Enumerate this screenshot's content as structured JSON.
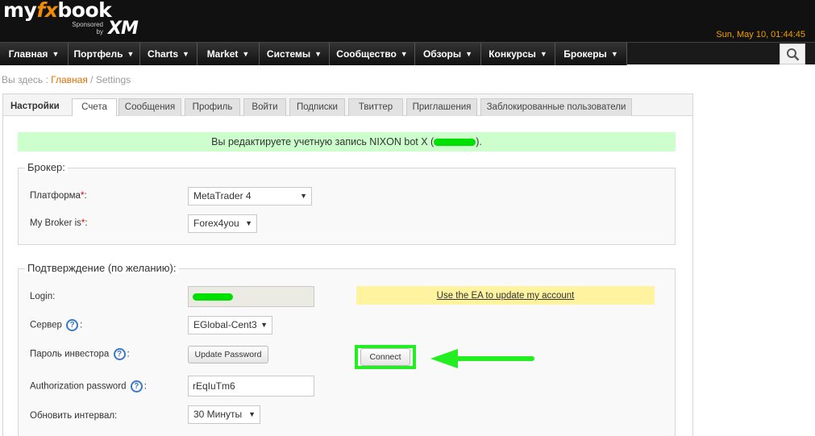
{
  "header": {
    "logo_my": "my",
    "logo_fx": "fx",
    "logo_book": "book",
    "sponsored_line1": "Sponsored",
    "sponsored_line2": "by",
    "sponsor": "XM",
    "datetime": "Sun, May 10, 01:44:45"
  },
  "nav": {
    "items": [
      {
        "label": "Главная",
        "caret": "▼"
      },
      {
        "label": "Портфель",
        "caret": "▼"
      },
      {
        "label": "Charts",
        "caret": "▼"
      },
      {
        "label": "Market",
        "caret": "▼"
      },
      {
        "label": "Системы",
        "caret": "▼"
      },
      {
        "label": "Сообщество",
        "caret": "▼"
      },
      {
        "label": "Обзоры",
        "caret": "▼"
      },
      {
        "label": "Конкурсы",
        "caret": "▼"
      },
      {
        "label": "Брокеры",
        "caret": "▼"
      }
    ],
    "search_icon": "search-icon"
  },
  "breadcrumb": {
    "prefix": "Вы здесь : ",
    "home": "Главная",
    "separator": " / ",
    "current": "Settings"
  },
  "tabs": {
    "heading": "Настройки",
    "items": [
      "Счета",
      "Сообщения",
      "Профиль",
      "Войти",
      "Подписки",
      "Твиттер",
      "Приглашения",
      "Заблокированные пользователи"
    ],
    "active": "Счета"
  },
  "notice": {
    "before": "Вы редактируете учетную запись NIXON bot X (",
    "after": ")."
  },
  "broker": {
    "legend": "Брокер:",
    "platform_label": "Платформа",
    "platform_value": "MetaTrader 4",
    "broker_label": "My Broker is",
    "broker_value": "Forex4you",
    "required_mark": "*",
    "colon": ":"
  },
  "confirmation": {
    "legend": "Подтверждение (по желанию):",
    "login_label": "Login:",
    "server_label": "Сервер",
    "server_value": "EGlobal-Cent3",
    "investor_label": "Пароль инвестора",
    "update_password_button": "Update Password",
    "connect_button": "Connect",
    "ea_link": "Use the EA to update my account",
    "auth_label": "Authorization password",
    "auth_value": "rEqIuTm6",
    "interval_label": "Обновить интервал:",
    "interval_value": "30 Минуты",
    "help_glyph": "?",
    "colon": ":"
  },
  "colors": {
    "accent": "#f08c00",
    "notice_bg": "#ccffcc",
    "highlight": "#22ee22",
    "ea_bg": "#fff3a0",
    "help": "#3a78c8"
  }
}
